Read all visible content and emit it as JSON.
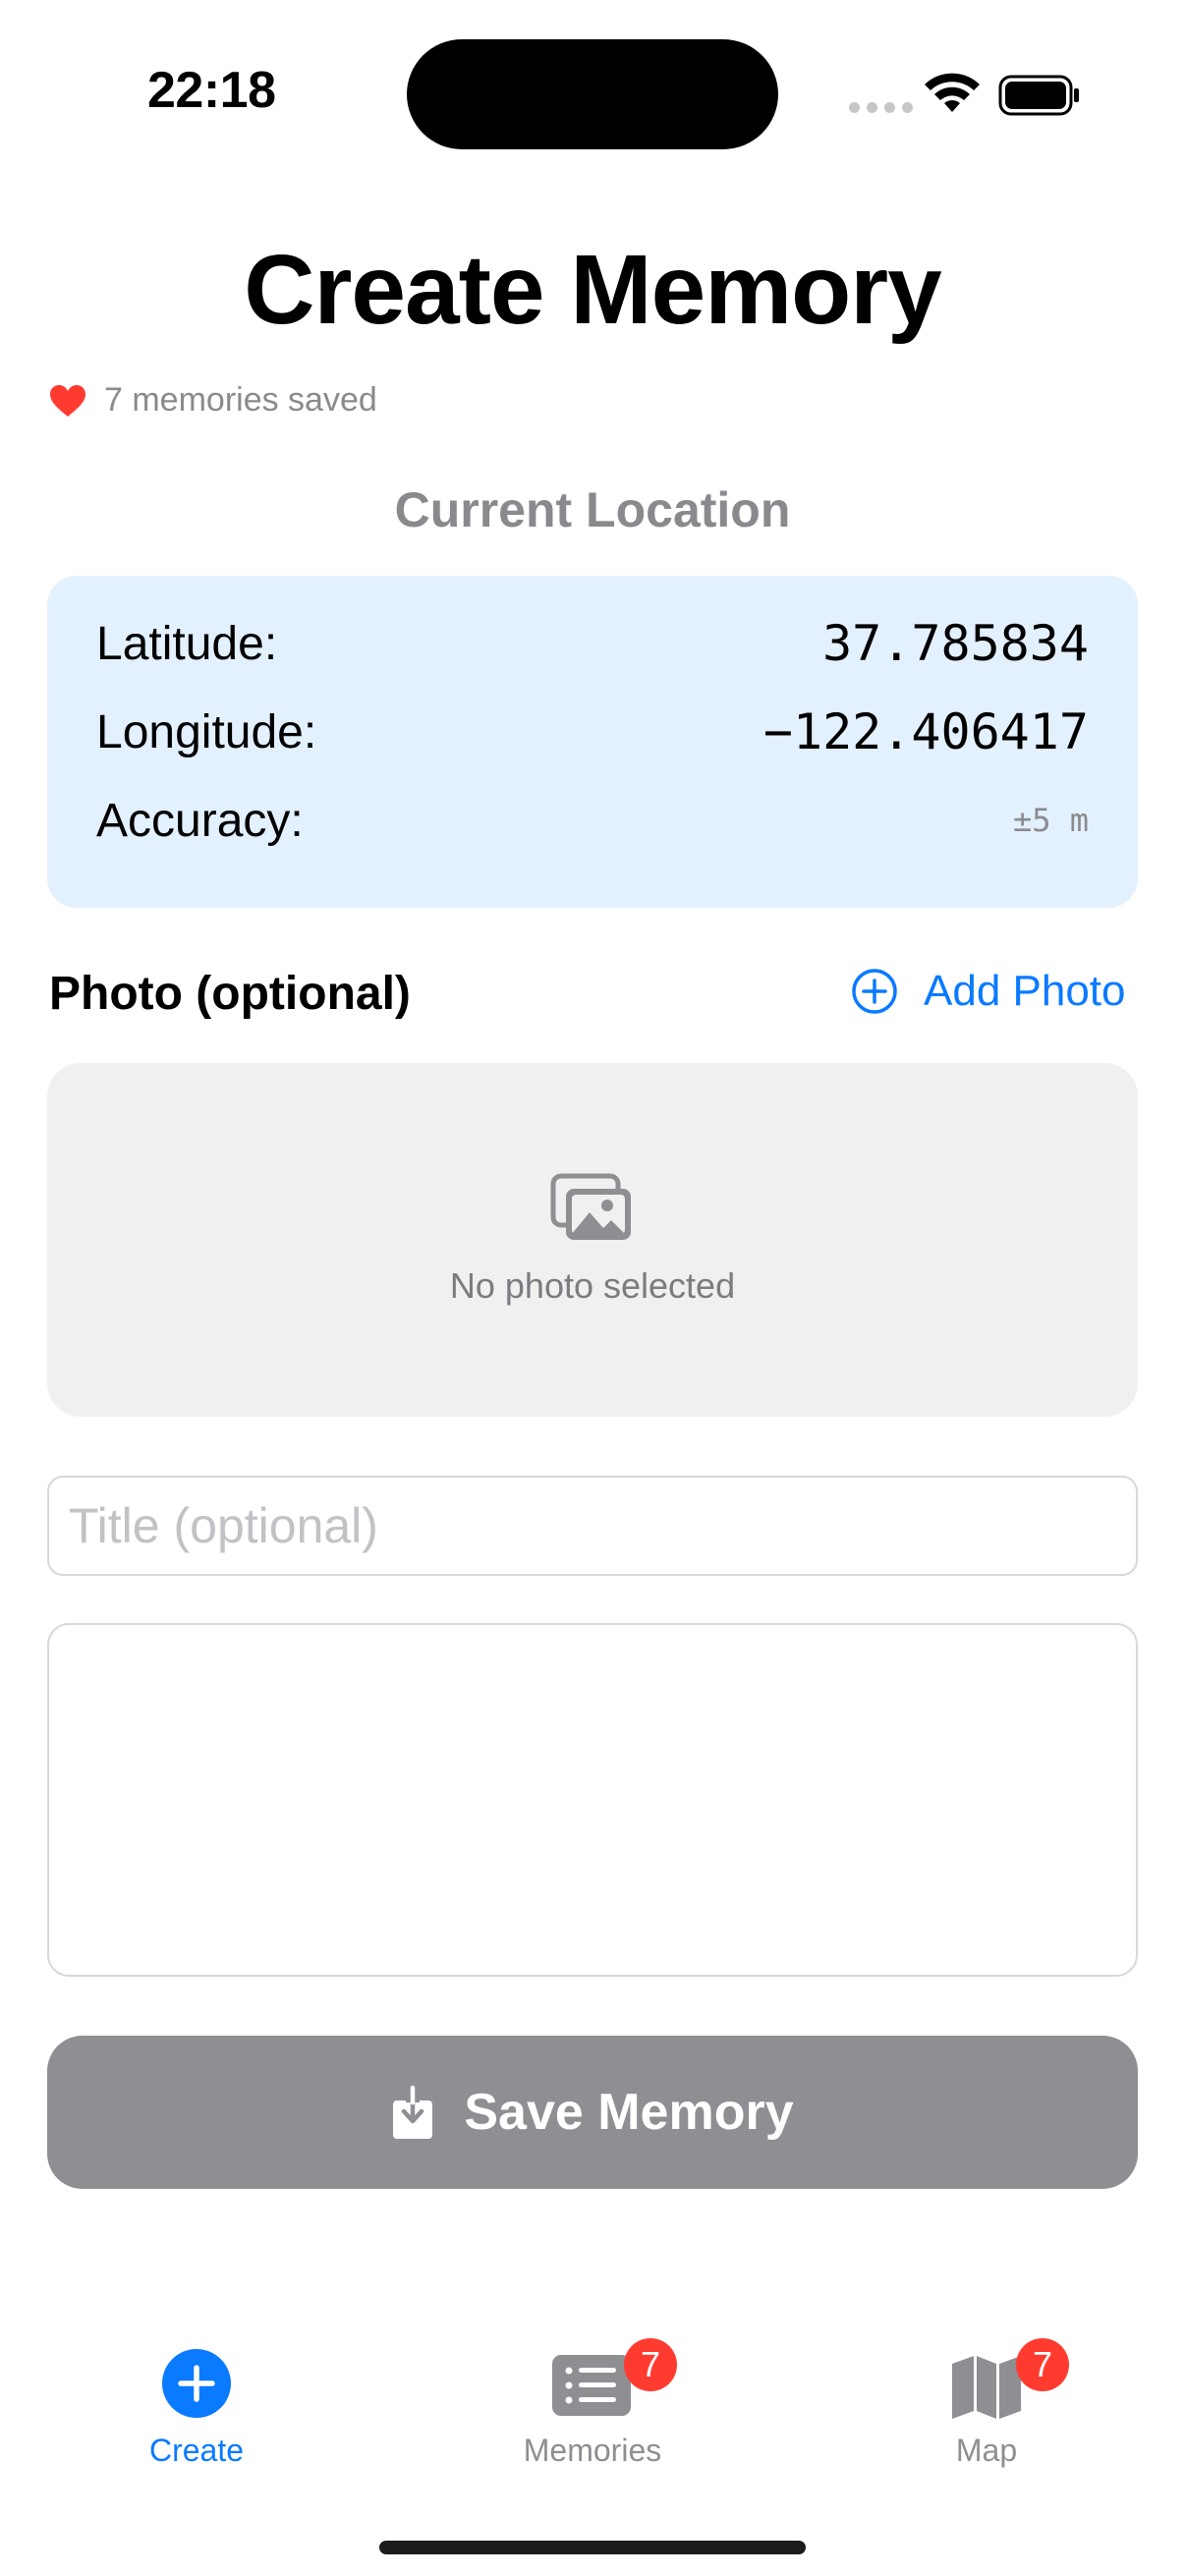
{
  "status_bar": {
    "time": "22:18"
  },
  "header": {
    "title": "Create Memory",
    "memories_saved": "7 memories saved"
  },
  "location": {
    "section_title": "Current Location",
    "rows": [
      {
        "label": "Latitude:",
        "value": "37.785834"
      },
      {
        "label": "Longitude:",
        "value": "−122.406417"
      },
      {
        "label": "Accuracy:",
        "value": "±5 m"
      }
    ]
  },
  "photo": {
    "label": "Photo (optional)",
    "add_label": "Add Photo",
    "empty_text": "No photo selected"
  },
  "form": {
    "title_placeholder": "Title (optional)",
    "title_value": "",
    "notes_value": ""
  },
  "save_button": {
    "label": "Save Memory"
  },
  "tabs": [
    {
      "label": "Create",
      "icon": "plus-circle-icon",
      "active": true,
      "badge": ""
    },
    {
      "label": "Memories",
      "icon": "list-icon",
      "active": false,
      "badge": "7"
    },
    {
      "label": "Map",
      "icon": "map-icon",
      "active": false,
      "badge": "7"
    }
  ],
  "colors": {
    "accent": "#0a7aff",
    "badge": "#ff3b30",
    "location_card_bg": "#e3f0fd",
    "disabled_button": "#8e8e93",
    "heart": "#ff3b30"
  }
}
